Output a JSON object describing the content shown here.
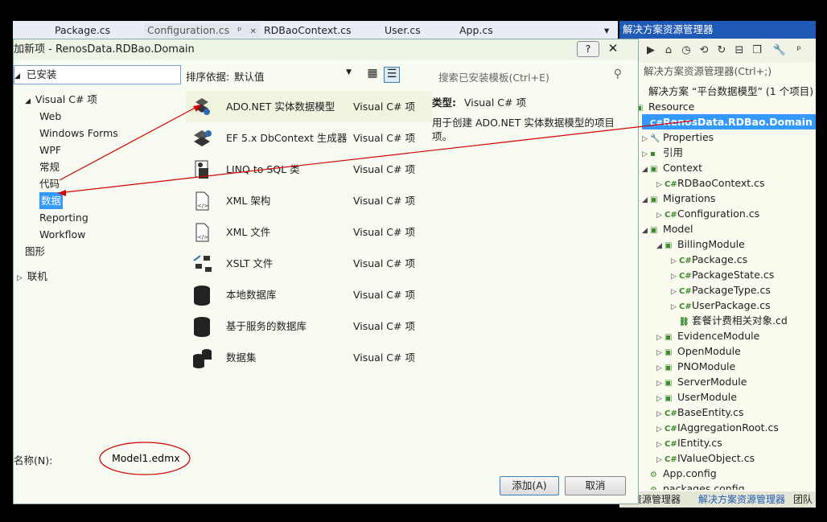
{
  "editor_tabs": [
    "Package.cs",
    "Configuration.cs",
    "RDBaoContext.cs",
    "User.cs",
    "App.cs"
  ],
  "editor_tab_pin": "ᵖ",
  "editor_tab_close": "✕",
  "editor_tab_dropdown": "▾",
  "solution_explorer": {
    "title": "解决方案资源管理器",
    "search_placeholder": "解决方案资源管理器(Ctrl+;)",
    "tree": [
      {
        "text": "解决方案 “平台数据模型” (1 个项目)",
        "indent": 0,
        "exp": "",
        "icon": ""
      },
      {
        "text": "Resource",
        "indent": 0,
        "exp": "",
        "icon": "▣"
      },
      {
        "text": "RenosData.RDBao.Domain",
        "indent": 0,
        "exp": "",
        "icon": "C#",
        "selected": true
      },
      {
        "text": "Properties",
        "indent": 1,
        "exp": "▷",
        "icon": "🔧"
      },
      {
        "text": "引用",
        "indent": 1,
        "exp": "▷",
        "icon": "▪"
      },
      {
        "text": "Context",
        "indent": 1,
        "exp": "◢",
        "icon": "▣"
      },
      {
        "text": "RDBaoContext.cs",
        "indent": 2,
        "exp": "▷",
        "icon": "C#"
      },
      {
        "text": "Migrations",
        "indent": 1,
        "exp": "◢",
        "icon": "▣"
      },
      {
        "text": "Configuration.cs",
        "indent": 2,
        "exp": "▷",
        "icon": "C#"
      },
      {
        "text": "Model",
        "indent": 1,
        "exp": "◢",
        "icon": "▣"
      },
      {
        "text": "BillingModule",
        "indent": 2,
        "exp": "◢",
        "icon": "▣"
      },
      {
        "text": "Package.cs",
        "indent": 3,
        "exp": "▷",
        "icon": "C#"
      },
      {
        "text": "PackageState.cs",
        "indent": 3,
        "exp": "▷",
        "icon": "C#"
      },
      {
        "text": "PackageType.cs",
        "indent": 3,
        "exp": "▷",
        "icon": "C#"
      },
      {
        "text": "UserPackage.cs",
        "indent": 3,
        "exp": "▷",
        "icon": "C#"
      },
      {
        "text": "套餐计费相关对象.cd",
        "indent": 3,
        "exp": "",
        "icon": "⛓"
      },
      {
        "text": "EvidenceModule",
        "indent": 2,
        "exp": "▷",
        "icon": "▣"
      },
      {
        "text": "OpenModule",
        "indent": 2,
        "exp": "▷",
        "icon": "▣"
      },
      {
        "text": "PNOModule",
        "indent": 2,
        "exp": "▷",
        "icon": "▣"
      },
      {
        "text": "ServerModule",
        "indent": 2,
        "exp": "▷",
        "icon": "▣"
      },
      {
        "text": "UserModule",
        "indent": 2,
        "exp": "▷",
        "icon": "▣"
      },
      {
        "text": "BaseEntity.cs",
        "indent": 2,
        "exp": "▷",
        "icon": "C#"
      },
      {
        "text": "IAggregationRoot.cs",
        "indent": 2,
        "exp": "▷",
        "icon": "C#"
      },
      {
        "text": "IEntity.cs",
        "indent": 2,
        "exp": "▷",
        "icon": "C#"
      },
      {
        "text": "IValueObject.cs",
        "indent": 2,
        "exp": "▷",
        "icon": "C#"
      },
      {
        "text": "App.config",
        "indent": 1,
        "exp": "",
        "icon": "⚙"
      },
      {
        "text": "packages.config",
        "indent": 1,
        "exp": "",
        "icon": "⚙"
      }
    ],
    "bottom_tabs": [
      "器资源管理器",
      "解决方案资源管理器",
      "团队"
    ],
    "accent": "#1f5bb6"
  },
  "dialog": {
    "title": "加新项 - RenosData.RDBao.Domain",
    "help": "?",
    "close": "✕",
    "installed": "已安装",
    "categories": [
      {
        "text": "Visual C# 项",
        "level": 0,
        "exp": "◢"
      },
      {
        "text": "Web",
        "level": 1
      },
      {
        "text": "Windows Forms",
        "level": 1
      },
      {
        "text": "WPF",
        "level": 1
      },
      {
        "text": "常规",
        "level": 1
      },
      {
        "text": "代码",
        "level": 1
      },
      {
        "text": "数据",
        "level": 1,
        "selected": true
      },
      {
        "text": "Reporting",
        "level": 1
      },
      {
        "text": "Workflow",
        "level": 1
      },
      {
        "text": "图形",
        "level": 0
      },
      {
        "text": "联机",
        "level": -1,
        "exp": "▷"
      }
    ],
    "sort_label": "排序依据:",
    "sort_value": "默认值",
    "search_placeholder": "搜索已安装模板(Ctrl+E)",
    "templates": [
      {
        "name": "ADO.NET 实体数据模型",
        "type": "Visual C# 项",
        "icon": "ado",
        "selected": true
      },
      {
        "name": "EF 5.x DbContext 生成器",
        "type": "Visual C# 项",
        "icon": "ef"
      },
      {
        "name": "LINQ to SQL 类",
        "type": "Visual C# 项",
        "icon": "linq"
      },
      {
        "name": "XML 架构",
        "type": "Visual C# 项",
        "icon": "xsd"
      },
      {
        "name": "XML 文件",
        "type": "Visual C# 项",
        "icon": "xml"
      },
      {
        "name": "XSLT 文件",
        "type": "Visual C# 项",
        "icon": "xslt"
      },
      {
        "name": "本地数据库",
        "type": "Visual C# 项",
        "icon": "db"
      },
      {
        "name": "基于服务的数据库",
        "type": "Visual C# 项",
        "icon": "db"
      },
      {
        "name": "数据集",
        "type": "Visual C# 项",
        "icon": "dataset"
      }
    ],
    "detail_type_label": "类型:",
    "detail_type_value": "Visual C# 项",
    "detail_desc": "用于创建 ADO.NET 实体数据模型的项目项。",
    "name_label": "名称(N):",
    "name_value": "Model1.edmx",
    "add_button": "添加(A)",
    "cancel_button": "取消"
  }
}
